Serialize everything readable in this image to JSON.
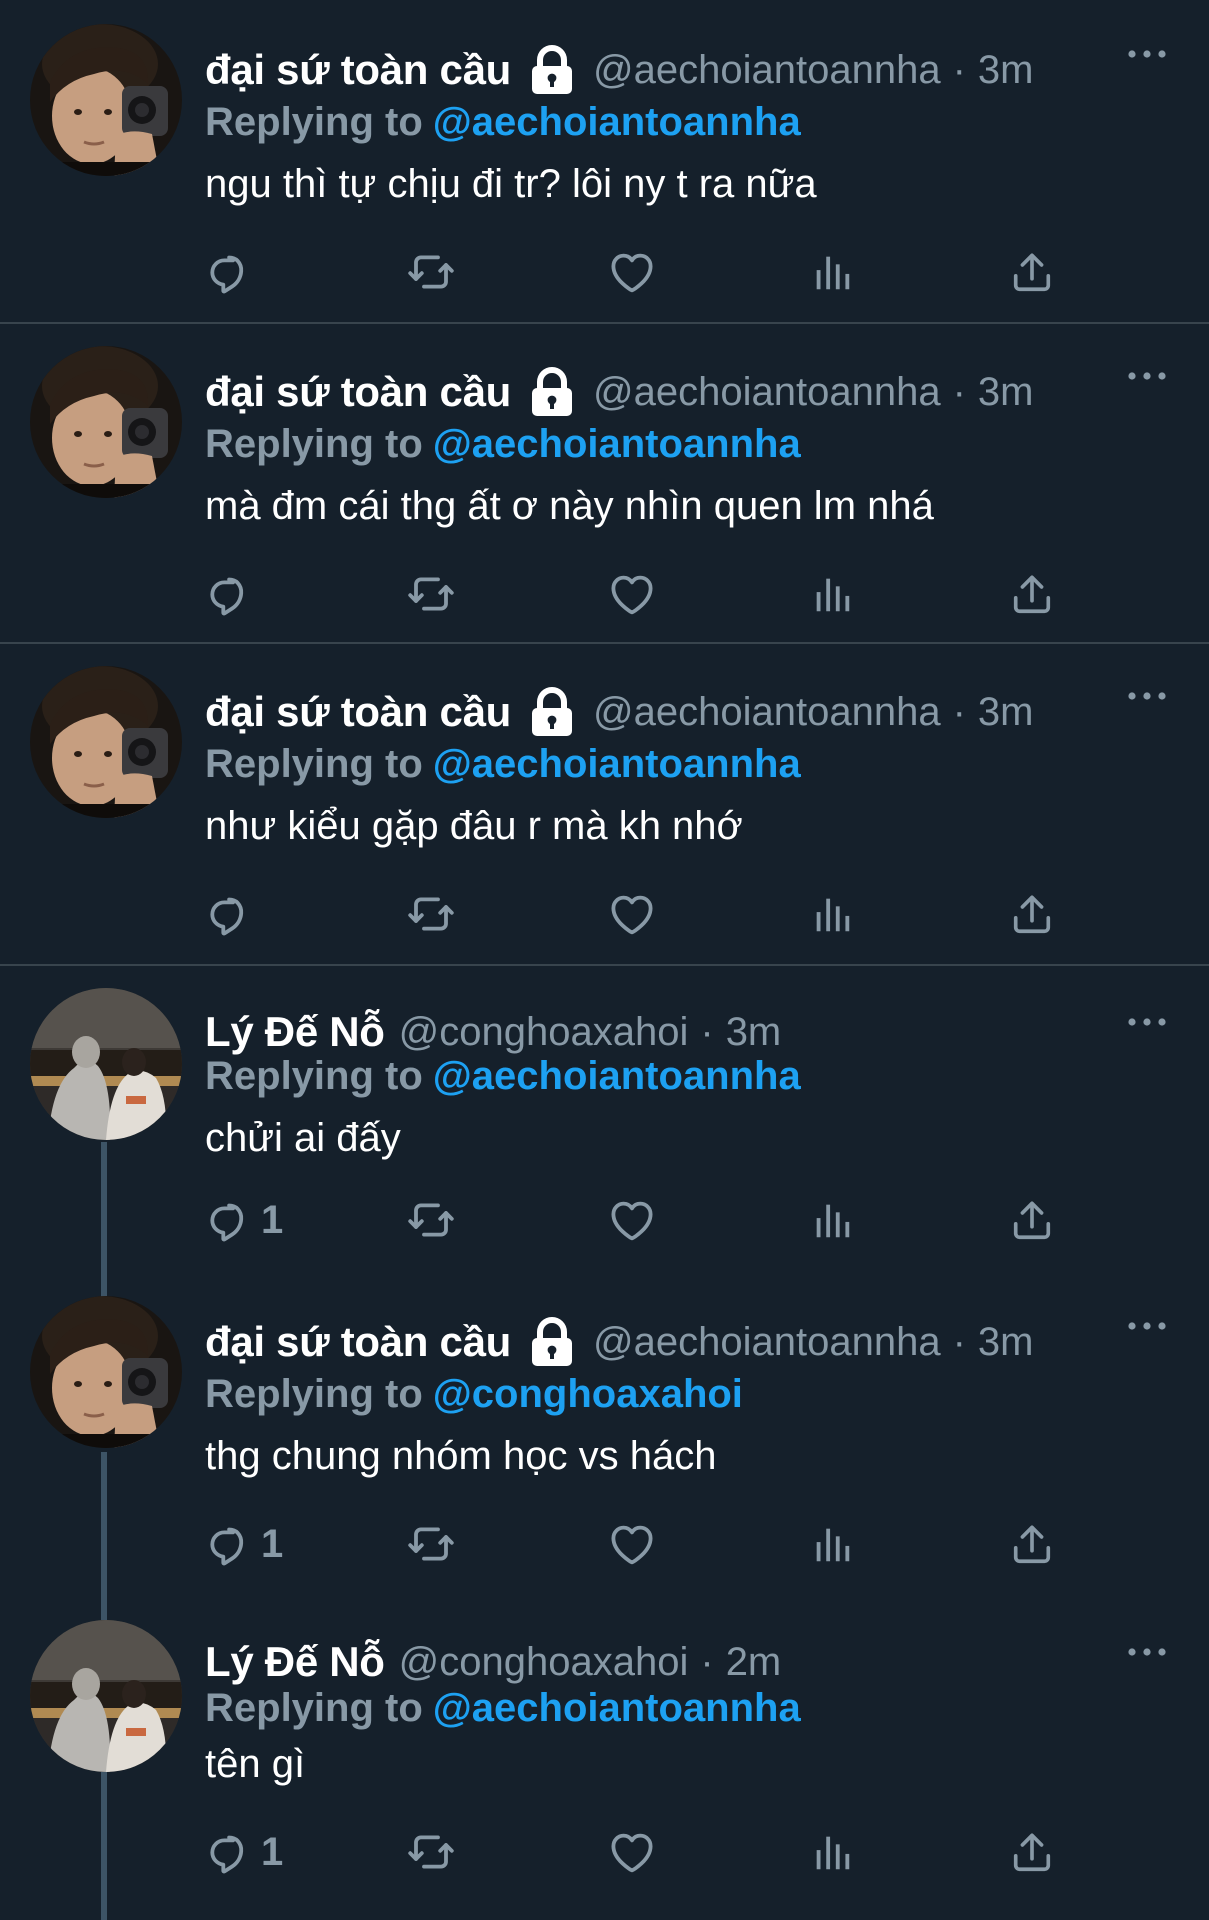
{
  "colors": {
    "background": "#15202b",
    "divider": "#38444d",
    "muted_text": "#8899a6",
    "link": "#1da1f2",
    "text": "#ffffff"
  },
  "icons": {
    "lock": "lock-icon",
    "more": "more-horizontal-icon",
    "reply": "reply-icon",
    "retweet": "retweet-icon",
    "like": "heart-icon",
    "analytics": "analytics-icon",
    "share": "share-icon"
  },
  "tweets": [
    {
      "display_name": "đại sứ toàn cầu",
      "protected": true,
      "handle": "@aechoiantoannha",
      "time": "3m",
      "reply_label": "Replying to",
      "reply_to": "@aechoiantoannha",
      "text": "ngu thì tự chịu đi tr? lôi ny t ra nữa",
      "reply_count": ""
    },
    {
      "display_name": "đại sứ toàn cầu",
      "protected": true,
      "handle": "@aechoiantoannha",
      "time": "3m",
      "reply_label": "Replying to",
      "reply_to": "@aechoiantoannha",
      "text": "mà đm cái thg ất ơ này nhìn quen lm nhá",
      "reply_count": ""
    },
    {
      "display_name": "đại sứ toàn cầu",
      "protected": true,
      "handle": "@aechoiantoannha",
      "time": "3m",
      "reply_label": "Replying to",
      "reply_to": "@aechoiantoannha",
      "text": "như kiểu gặp đâu r mà kh nhớ",
      "reply_count": ""
    },
    {
      "display_name": "Lý Đế Nỗ",
      "protected": false,
      "handle": "@conghoaxahoi",
      "time": "3m",
      "reply_label": "Replying to",
      "reply_to": "@aechoiantoannha",
      "text": "chửi ai đấy",
      "reply_count": "1"
    },
    {
      "display_name": "đại sứ toàn cầu",
      "protected": true,
      "handle": "@aechoiantoannha",
      "time": "3m",
      "reply_label": "Replying to",
      "reply_to": "@conghoaxahoi",
      "text": "thg chung nhóm học vs hách",
      "reply_count": "1"
    },
    {
      "display_name": "Lý Đế Nỗ",
      "protected": false,
      "handle": "@conghoaxahoi",
      "time": "2m",
      "reply_label": "Replying to",
      "reply_to": "@aechoiantoannha",
      "text": "tên gì",
      "reply_count": "1"
    }
  ]
}
